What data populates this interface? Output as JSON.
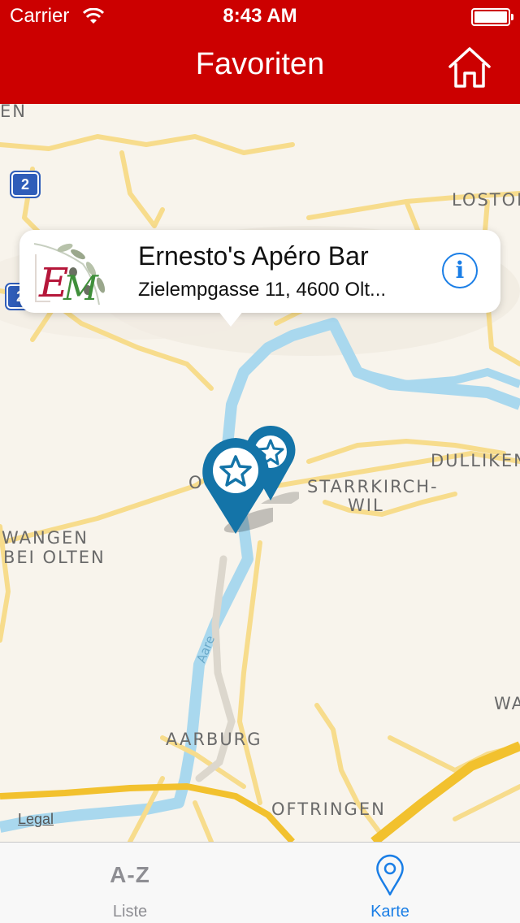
{
  "status_bar": {
    "carrier": "Carrier",
    "time": "8:43 AM"
  },
  "nav": {
    "title": "Favoriten",
    "home_icon": "home-icon"
  },
  "map": {
    "labels": {
      "en": "EN",
      "lostorf": "LOSTOR",
      "dulliken": "DULLIKEN",
      "starrkirch_1": "STARRKIRCH-",
      "starrkirch_2": "WIL",
      "wangen_1": "WANGEN",
      "wangen_2": "BEI OLTEN",
      "aarburg": "AARBURG",
      "oftringen": "OFTRINGEN",
      "wa": "WA",
      "aare": "Aare",
      "olten_partial": "O"
    },
    "road_shields": [
      "2",
      "2"
    ],
    "legal": "Legal",
    "colors": {
      "background": "#f8f4ec",
      "road": "#f7dc8c",
      "highway": "#f2c12e",
      "water": "#a9d8ee"
    }
  },
  "callout": {
    "title": "Ernesto's Apéro Bar",
    "address": "Zielempgasse 11, 4600 Olt...",
    "logo_text": "EM",
    "info_icon": "info-icon",
    "info_glyph": "i"
  },
  "tabs": [
    {
      "glyph": "A-Z",
      "label": "Liste",
      "selected": false
    },
    {
      "glyph": "map-pin-icon",
      "label": "Karte",
      "selected": true
    }
  ],
  "colors": {
    "header": "#cc0000",
    "accent": "#1a7ee6",
    "pin": "#1474a8"
  }
}
